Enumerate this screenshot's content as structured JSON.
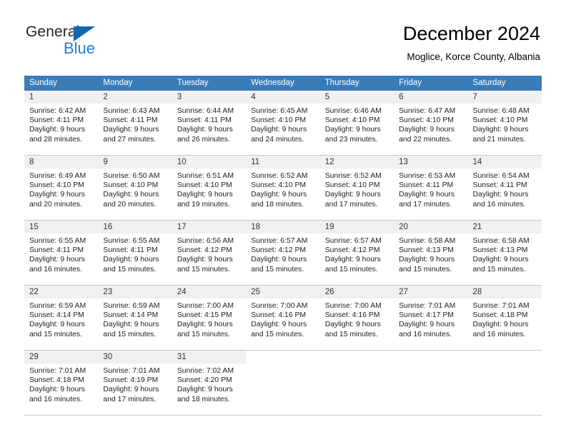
{
  "logo": {
    "primary_text": "General",
    "secondary_text": "Blue",
    "primary_color": "#231f20",
    "secondary_color": "#1f7fd0",
    "triangle_color": "#1267b1"
  },
  "header": {
    "title": "December 2024",
    "subtitle": "Moglice, Korce County, Albania"
  },
  "theme": {
    "header_row_bg": "#3b7cb8",
    "header_row_text": "#ffffff",
    "daynum_bg": "#f0f0f0",
    "cell_bg": "#ffffff",
    "separator": "#c8c8c8"
  },
  "calendar": {
    "weekday_headers": [
      "Sunday",
      "Monday",
      "Tuesday",
      "Wednesday",
      "Thursday",
      "Friday",
      "Saturday"
    ],
    "weeks": [
      [
        {
          "day": "1",
          "sunrise": "Sunrise: 6:42 AM",
          "sunset": "Sunset: 4:11 PM",
          "daylight_line1": "Daylight: 9 hours",
          "daylight_line2": "and 28 minutes."
        },
        {
          "day": "2",
          "sunrise": "Sunrise: 6:43 AM",
          "sunset": "Sunset: 4:11 PM",
          "daylight_line1": "Daylight: 9 hours",
          "daylight_line2": "and 27 minutes."
        },
        {
          "day": "3",
          "sunrise": "Sunrise: 6:44 AM",
          "sunset": "Sunset: 4:11 PM",
          "daylight_line1": "Daylight: 9 hours",
          "daylight_line2": "and 26 minutes."
        },
        {
          "day": "4",
          "sunrise": "Sunrise: 6:45 AM",
          "sunset": "Sunset: 4:10 PM",
          "daylight_line1": "Daylight: 9 hours",
          "daylight_line2": "and 24 minutes."
        },
        {
          "day": "5",
          "sunrise": "Sunrise: 6:46 AM",
          "sunset": "Sunset: 4:10 PM",
          "daylight_line1": "Daylight: 9 hours",
          "daylight_line2": "and 23 minutes."
        },
        {
          "day": "6",
          "sunrise": "Sunrise: 6:47 AM",
          "sunset": "Sunset: 4:10 PM",
          "daylight_line1": "Daylight: 9 hours",
          "daylight_line2": "and 22 minutes."
        },
        {
          "day": "7",
          "sunrise": "Sunrise: 6:48 AM",
          "sunset": "Sunset: 4:10 PM",
          "daylight_line1": "Daylight: 9 hours",
          "daylight_line2": "and 21 minutes."
        }
      ],
      [
        {
          "day": "8",
          "sunrise": "Sunrise: 6:49 AM",
          "sunset": "Sunset: 4:10 PM",
          "daylight_line1": "Daylight: 9 hours",
          "daylight_line2": "and 20 minutes."
        },
        {
          "day": "9",
          "sunrise": "Sunrise: 6:50 AM",
          "sunset": "Sunset: 4:10 PM",
          "daylight_line1": "Daylight: 9 hours",
          "daylight_line2": "and 20 minutes."
        },
        {
          "day": "10",
          "sunrise": "Sunrise: 6:51 AM",
          "sunset": "Sunset: 4:10 PM",
          "daylight_line1": "Daylight: 9 hours",
          "daylight_line2": "and 19 minutes."
        },
        {
          "day": "11",
          "sunrise": "Sunrise: 6:52 AM",
          "sunset": "Sunset: 4:10 PM",
          "daylight_line1": "Daylight: 9 hours",
          "daylight_line2": "and 18 minutes."
        },
        {
          "day": "12",
          "sunrise": "Sunrise: 6:52 AM",
          "sunset": "Sunset: 4:10 PM",
          "daylight_line1": "Daylight: 9 hours",
          "daylight_line2": "and 17 minutes."
        },
        {
          "day": "13",
          "sunrise": "Sunrise: 6:53 AM",
          "sunset": "Sunset: 4:11 PM",
          "daylight_line1": "Daylight: 9 hours",
          "daylight_line2": "and 17 minutes."
        },
        {
          "day": "14",
          "sunrise": "Sunrise: 6:54 AM",
          "sunset": "Sunset: 4:11 PM",
          "daylight_line1": "Daylight: 9 hours",
          "daylight_line2": "and 16 minutes."
        }
      ],
      [
        {
          "day": "15",
          "sunrise": "Sunrise: 6:55 AM",
          "sunset": "Sunset: 4:11 PM",
          "daylight_line1": "Daylight: 9 hours",
          "daylight_line2": "and 16 minutes."
        },
        {
          "day": "16",
          "sunrise": "Sunrise: 6:55 AM",
          "sunset": "Sunset: 4:11 PM",
          "daylight_line1": "Daylight: 9 hours",
          "daylight_line2": "and 15 minutes."
        },
        {
          "day": "17",
          "sunrise": "Sunrise: 6:56 AM",
          "sunset": "Sunset: 4:12 PM",
          "daylight_line1": "Daylight: 9 hours",
          "daylight_line2": "and 15 minutes."
        },
        {
          "day": "18",
          "sunrise": "Sunrise: 6:57 AM",
          "sunset": "Sunset: 4:12 PM",
          "daylight_line1": "Daylight: 9 hours",
          "daylight_line2": "and 15 minutes."
        },
        {
          "day": "19",
          "sunrise": "Sunrise: 6:57 AM",
          "sunset": "Sunset: 4:12 PM",
          "daylight_line1": "Daylight: 9 hours",
          "daylight_line2": "and 15 minutes."
        },
        {
          "day": "20",
          "sunrise": "Sunrise: 6:58 AM",
          "sunset": "Sunset: 4:13 PM",
          "daylight_line1": "Daylight: 9 hours",
          "daylight_line2": "and 15 minutes."
        },
        {
          "day": "21",
          "sunrise": "Sunrise: 6:58 AM",
          "sunset": "Sunset: 4:13 PM",
          "daylight_line1": "Daylight: 9 hours",
          "daylight_line2": "and 15 minutes."
        }
      ],
      [
        {
          "day": "22",
          "sunrise": "Sunrise: 6:59 AM",
          "sunset": "Sunset: 4:14 PM",
          "daylight_line1": "Daylight: 9 hours",
          "daylight_line2": "and 15 minutes."
        },
        {
          "day": "23",
          "sunrise": "Sunrise: 6:59 AM",
          "sunset": "Sunset: 4:14 PM",
          "daylight_line1": "Daylight: 9 hours",
          "daylight_line2": "and 15 minutes."
        },
        {
          "day": "24",
          "sunrise": "Sunrise: 7:00 AM",
          "sunset": "Sunset: 4:15 PM",
          "daylight_line1": "Daylight: 9 hours",
          "daylight_line2": "and 15 minutes."
        },
        {
          "day": "25",
          "sunrise": "Sunrise: 7:00 AM",
          "sunset": "Sunset: 4:16 PM",
          "daylight_line1": "Daylight: 9 hours",
          "daylight_line2": "and 15 minutes."
        },
        {
          "day": "26",
          "sunrise": "Sunrise: 7:00 AM",
          "sunset": "Sunset: 4:16 PM",
          "daylight_line1": "Daylight: 9 hours",
          "daylight_line2": "and 15 minutes."
        },
        {
          "day": "27",
          "sunrise": "Sunrise: 7:01 AM",
          "sunset": "Sunset: 4:17 PM",
          "daylight_line1": "Daylight: 9 hours",
          "daylight_line2": "and 16 minutes."
        },
        {
          "day": "28",
          "sunrise": "Sunrise: 7:01 AM",
          "sunset": "Sunset: 4:18 PM",
          "daylight_line1": "Daylight: 9 hours",
          "daylight_line2": "and 16 minutes."
        }
      ],
      [
        {
          "day": "29",
          "sunrise": "Sunrise: 7:01 AM",
          "sunset": "Sunset: 4:18 PM",
          "daylight_line1": "Daylight: 9 hours",
          "daylight_line2": "and 16 minutes."
        },
        {
          "day": "30",
          "sunrise": "Sunrise: 7:01 AM",
          "sunset": "Sunset: 4:19 PM",
          "daylight_line1": "Daylight: 9 hours",
          "daylight_line2": "and 17 minutes."
        },
        {
          "day": "31",
          "sunrise": "Sunrise: 7:02 AM",
          "sunset": "Sunset: 4:20 PM",
          "daylight_line1": "Daylight: 9 hours",
          "daylight_line2": "and 18 minutes."
        },
        {
          "day": "",
          "sunrise": "",
          "sunset": "",
          "daylight_line1": "",
          "daylight_line2": ""
        },
        {
          "day": "",
          "sunrise": "",
          "sunset": "",
          "daylight_line1": "",
          "daylight_line2": ""
        },
        {
          "day": "",
          "sunrise": "",
          "sunset": "",
          "daylight_line1": "",
          "daylight_line2": ""
        },
        {
          "day": "",
          "sunrise": "",
          "sunset": "",
          "daylight_line1": "",
          "daylight_line2": ""
        }
      ]
    ]
  }
}
